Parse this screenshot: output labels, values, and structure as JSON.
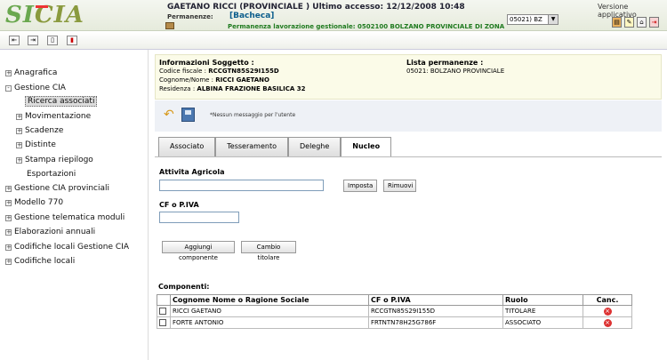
{
  "header": {
    "logo_part1": "SI",
    "logo_part2": "CIA",
    "user_line": "GAETANO RICCI (PROVINCIALE ) Ultimo accesso: 12/12/2008 10:48",
    "permanenze_label": "Permanenze:",
    "permanenze_value": "[Bacheca]",
    "permanenza_lavorazione": "Permanenza lavorazione gestionale: 0502100 BOLZANO PROVINCIALE DI ZONA",
    "selector_value": "05021) BZ",
    "versione_link": "Versione applicativo"
  },
  "sidebar": {
    "items": [
      {
        "label": "Anagrafica",
        "expander": "+"
      },
      {
        "label": "Gestione CIA",
        "expander": "-"
      },
      {
        "label": "Ricerca associati",
        "expander": ""
      },
      {
        "label": "Movimentazione",
        "expander": "+"
      },
      {
        "label": "Scadenze",
        "expander": "+"
      },
      {
        "label": "Distinte",
        "expander": "+"
      },
      {
        "label": "Stampa riepilogo",
        "expander": "+"
      },
      {
        "label": "Esportazioni",
        "expander": ""
      },
      {
        "label": "Gestione CIA provinciali",
        "expander": "+"
      },
      {
        "label": "Modello 770",
        "expander": "+"
      },
      {
        "label": "Gestione telematica moduli",
        "expander": "+"
      },
      {
        "label": "Elaborazioni annuali",
        "expander": "+"
      },
      {
        "label": "Codifiche locali Gestione CIA",
        "expander": "+"
      },
      {
        "label": "Codifiche locali",
        "expander": "+"
      }
    ]
  },
  "info": {
    "title": "Informazioni Soggetto :",
    "codice_fiscale_label": "Codice fiscale :",
    "codice_fiscale": "RCCGTN85S29I155D",
    "nome_label": "Cognome/Nome :",
    "nome": "RICCI GAETANO",
    "residenza_label": "Residenza :",
    "residenza": "ALBINA  FRAZIONE BASILICA 32",
    "lista_title": "Lista permanenze :",
    "lista_value": "05021: BOLZANO PROVINCIALE"
  },
  "message": "*Nessun messaggio per l'utente",
  "tabs": [
    "Associato",
    "Tesseramento",
    "Deleghe",
    "Nucleo"
  ],
  "active_tab": "Nucleo",
  "form": {
    "attivita_label": "Attivita Agricola",
    "attivita_value": "",
    "imposta_label": "Imposta",
    "rimuovi_label": "Rimuovi",
    "cf_label": "CF o P.IVA",
    "cf_value": "",
    "aggiungi_label": "Aggiungi componente",
    "cambio_label": "Cambio titolare"
  },
  "componenti": {
    "title": "Componenti:",
    "headers": [
      "",
      "Cognome Nome o Ragione Sociale",
      "CF o P.IVA",
      "Ruolo",
      "Canc."
    ],
    "rows": [
      {
        "nome": "RICCI GAETANO",
        "cf": "RCCGTN85S29I155D",
        "ruolo": "TITOLARE"
      },
      {
        "nome": "FORTE ANTONIO",
        "cf": "FRTNTN78H25G786F",
        "ruolo": "ASSOCIATO"
      }
    ]
  }
}
